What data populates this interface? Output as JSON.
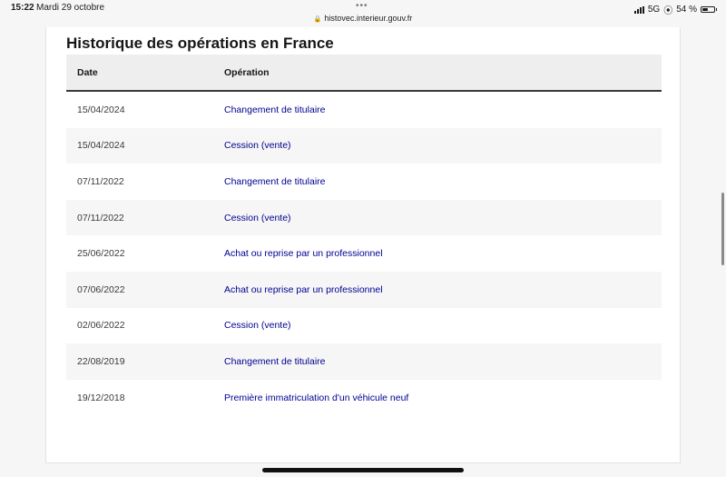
{
  "status_bar": {
    "time": "15:22",
    "date": "Mardi 29 octobre",
    "url": "histovec.interieur.gouv.fr",
    "network": "5G",
    "battery_percent": "54 %",
    "battery_level": 0.54
  },
  "section": {
    "title": "Historique des opérations en France"
  },
  "table": {
    "headers": {
      "date": "Date",
      "operation": "Opération"
    },
    "rows": [
      {
        "date": "15/04/2024",
        "operation": "Changement de titulaire"
      },
      {
        "date": "15/04/2024",
        "operation": "Cession (vente)"
      },
      {
        "date": "07/11/2022",
        "operation": "Changement de titulaire"
      },
      {
        "date": "07/11/2022",
        "operation": "Cession (vente)"
      },
      {
        "date": "25/06/2022",
        "operation": "Achat ou reprise par un professionnel"
      },
      {
        "date": "07/06/2022",
        "operation": "Achat ou reprise par un professionnel"
      },
      {
        "date": "02/06/2022",
        "operation": "Cession (vente)"
      },
      {
        "date": "22/08/2019",
        "operation": "Changement de titulaire"
      },
      {
        "date": "19/12/2018",
        "operation": "Première immatriculation d'un véhicule neuf"
      }
    ]
  },
  "colors": {
    "link": "#000091",
    "header_bg": "#eeeeee",
    "row_alt_bg": "#f6f6f6"
  }
}
